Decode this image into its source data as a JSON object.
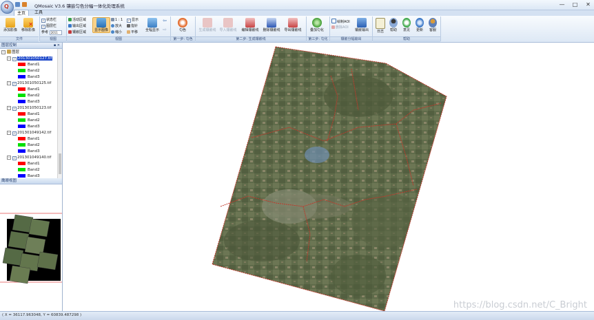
{
  "window": {
    "title": "QMosaic V3.6 镶嵌匀色分幅一体化处理系统",
    "controls": [
      "—",
      "□",
      "✕"
    ]
  },
  "ribbon_tabs": [
    {
      "label": "主页",
      "active": true
    },
    {
      "label": "工具",
      "active": false
    }
  ],
  "ribbon": {
    "file": {
      "add_image": "添加影像",
      "remove_image": "移除影像",
      "group": "文件"
    },
    "display": {
      "status_bar": "状态栏",
      "layer_bar": "图层栏",
      "reference_label": "参考",
      "reference_value": "2011",
      "group": "视图"
    },
    "view": {
      "valid_region": "活动区域",
      "output_region": "输出区域",
      "mosaic_region": "镶嵌区域",
      "show_image": "显示图像",
      "scale_1_1": "1 : 1",
      "zoom_in": "放大",
      "zoom_out": "缩小",
      "show": "显示",
      "pointer": "指针",
      "pan": "平移",
      "full_view": "全幅显示",
      "group": "视图"
    },
    "step1": {
      "dodge": "匀色",
      "group": "第一步: 匀色"
    },
    "step2": {
      "generate_seamline": "生成镶嵌线",
      "import_seamline": "导入镶嵌线",
      "edit_seamline": "编辑镶嵌线",
      "delete_seamline": "删除镶嵌线",
      "export_seamline": "导出镶嵌线",
      "group": "第二步: 生成镶嵌线"
    },
    "step3": {
      "overlay_dodge": "叠加匀化",
      "group": "第三步: 匀化"
    },
    "step4": {
      "draw_aoi": "绘制AOI",
      "delete_aoi": "删除AOI",
      "mosaic_output": "镶嵌输出",
      "group": "镶嵌分幅输出"
    },
    "help": {
      "log": "日志",
      "help": "帮助",
      "feedback": "意见",
      "update": "更新",
      "service": "客服",
      "group": "帮助"
    }
  },
  "layer_panel": {
    "title": "图层控制",
    "root": "图层",
    "layers": [
      {
        "name": "201301050127.tif",
        "selected": true
      },
      {
        "name": "201301050125.tif",
        "selected": false
      },
      {
        "name": "201301050123.tif",
        "selected": false
      },
      {
        "name": "201301049142.tif",
        "selected": false
      },
      {
        "name": "201301049140.tif",
        "selected": false
      }
    ],
    "bands": [
      {
        "name": "Band1",
        "color": "#ff0000"
      },
      {
        "name": "Band2",
        "color": "#00e000"
      },
      {
        "name": "Band3",
        "color": "#0000ff"
      }
    ]
  },
  "overview_panel": {
    "title": "鹰眼视图"
  },
  "status": {
    "coords": "( X = 36117.963048, Y = 60839.487298 )"
  },
  "watermark": "https://blog.csdn.net/C_Bright",
  "colors": {
    "seamline": "#c0392b",
    "selected": "#1b46c9",
    "ribbon_bg": "#dde8f5"
  }
}
